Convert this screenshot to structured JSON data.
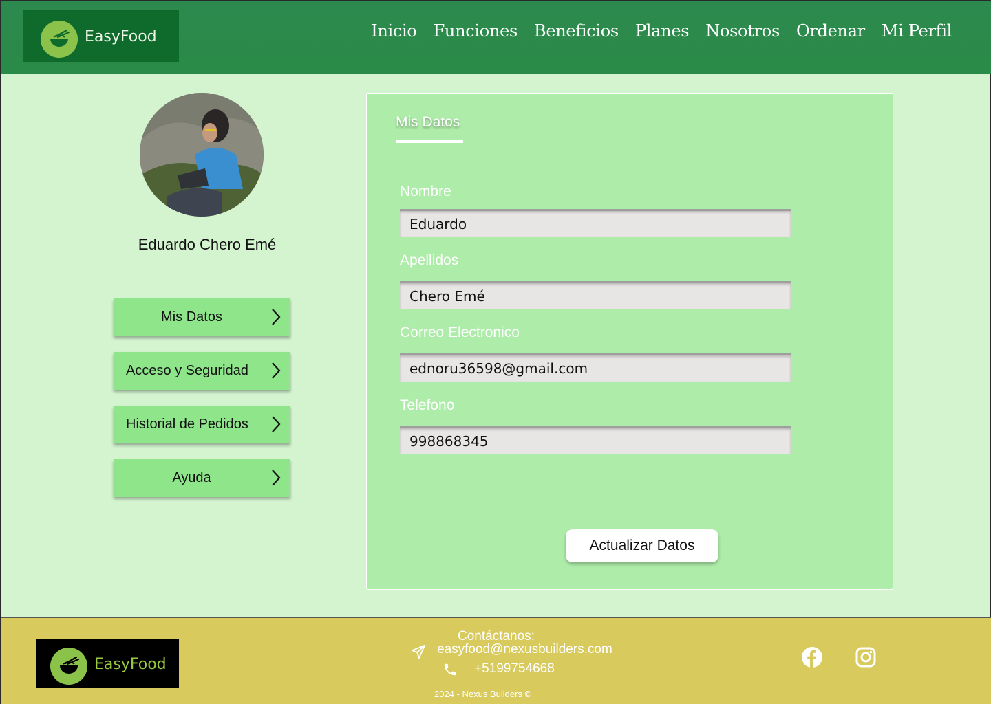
{
  "brand": {
    "name": "EasyFood"
  },
  "nav": {
    "items": [
      "Inicio",
      "Funciones",
      "Beneficios",
      "Planes",
      "Nosotros",
      "Ordenar",
      "Mi Perfil"
    ]
  },
  "profile": {
    "name": "Eduardo Chero Emé"
  },
  "sidebar": {
    "items": [
      {
        "label": "Mis Datos"
      },
      {
        "label": "Acceso y Seguridad"
      },
      {
        "label": "Historial de Pedidos"
      },
      {
        "label": "Ayuda"
      }
    ]
  },
  "form": {
    "tab": "Mis Datos",
    "fields": [
      {
        "label": "Nombre",
        "value": "Eduardo"
      },
      {
        "label": "Apellidos",
        "value": "Chero Emé"
      },
      {
        "label": "Correo Electronico",
        "value": "ednoru36598@gmail.com"
      },
      {
        "label": "Telefono",
        "value": "998868345"
      }
    ],
    "submit": "Actualizar Datos"
  },
  "footer": {
    "brand": "EasyFood",
    "contact_title": "Contáctanos:",
    "email": "easyfood@nexusbuilders.com",
    "phone": "+5199754668",
    "copyright": "2024 - Nexus Builders ©",
    "social": [
      "facebook-icon",
      "instagram-icon"
    ]
  },
  "colors": {
    "header": "#2d8a4f",
    "background": "#d3f4cf",
    "card": "#aeeca9",
    "sidebar_button": "#8ee58a",
    "footer": "#d8ca5c"
  }
}
